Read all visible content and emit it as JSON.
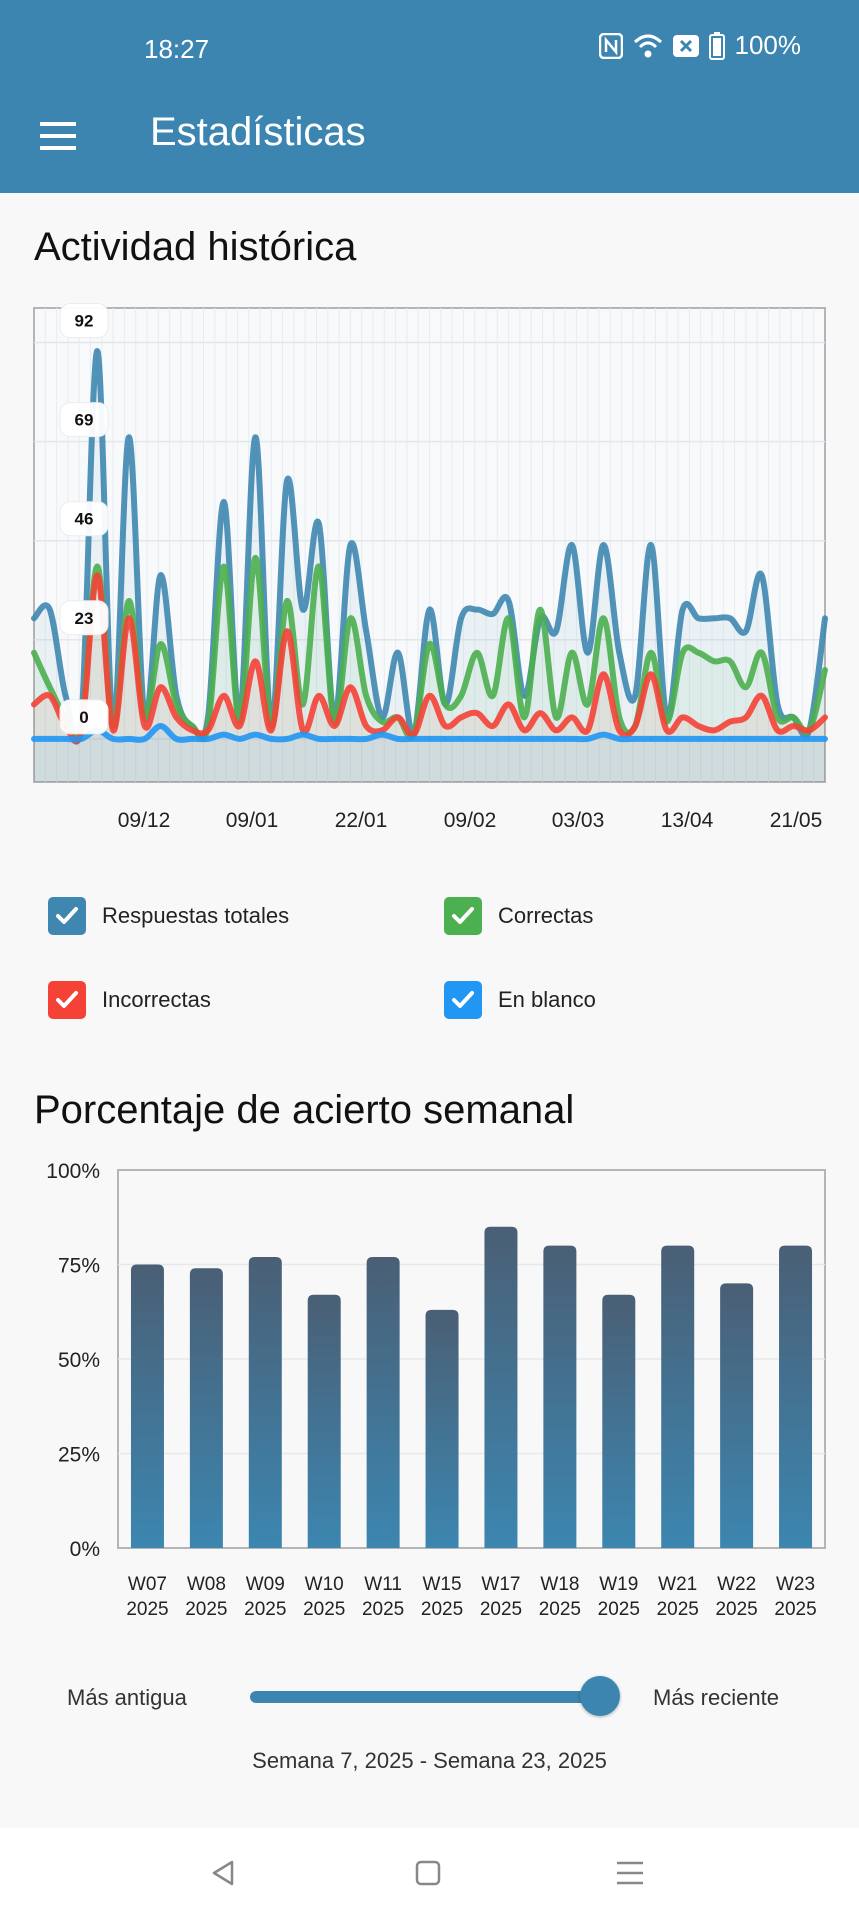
{
  "status": {
    "time": "18:27",
    "battery": "100%"
  },
  "app_bar": {
    "title": "Estadísticas",
    "accent": "#3c85b0"
  },
  "sections": {
    "history_title": "Actividad histórica",
    "weekly_title": "Porcentaje de acierto semanal"
  },
  "legend": [
    {
      "label": "Respuestas totales",
      "color": "#3f87b0",
      "checked": true
    },
    {
      "label": "Correctas",
      "color": "#4caf50",
      "checked": true
    },
    {
      "label": "Incorrectas",
      "color": "#f44336",
      "checked": true
    },
    {
      "label": "En blanco",
      "color": "#2196f3",
      "checked": true
    }
  ],
  "chart_data": [
    {
      "type": "line",
      "x_ticks": [
        "09/12",
        "09/01",
        "22/01",
        "09/02",
        "03/03",
        "13/04",
        "21/05"
      ],
      "y_ticks": [
        0,
        23,
        46,
        69,
        92
      ],
      "ylim": [
        -10,
        100
      ],
      "grid": true,
      "series": [
        {
          "name": "Respuestas totales",
          "color": "#3f87b0",
          "values": [
            28,
            30,
            10,
            5,
            90,
            3,
            70,
            5,
            38,
            10,
            3,
            5,
            55,
            5,
            70,
            3,
            60,
            30,
            50,
            5,
            45,
            25,
            5,
            20,
            1,
            30,
            8,
            28,
            30,
            29,
            32,
            10,
            28,
            25,
            45,
            20,
            45,
            20,
            10,
            45,
            5,
            30,
            28,
            28,
            28,
            25,
            38,
            8,
            5,
            2,
            28
          ]
        },
        {
          "name": "Correctas",
          "color": "#4caf50",
          "values": [
            20,
            12,
            5,
            3,
            40,
            3,
            32,
            5,
            22,
            8,
            3,
            3,
            40,
            4,
            42,
            3,
            32,
            8,
            40,
            4,
            28,
            10,
            4,
            5,
            1,
            22,
            8,
            10,
            20,
            10,
            28,
            5,
            30,
            5,
            20,
            8,
            28,
            5,
            3,
            20,
            4,
            20,
            20,
            18,
            18,
            12,
            20,
            5,
            5,
            2,
            16
          ]
        },
        {
          "name": "Incorrectas",
          "color": "#f44336",
          "values": [
            8,
            10,
            3,
            2,
            38,
            2,
            28,
            3,
            12,
            5,
            2,
            2,
            10,
            3,
            18,
            2,
            25,
            2,
            10,
            3,
            12,
            3,
            2,
            5,
            1,
            10,
            3,
            5,
            6,
            3,
            8,
            2,
            6,
            2,
            5,
            2,
            15,
            2,
            3,
            15,
            2,
            5,
            3,
            2,
            4,
            5,
            10,
            2,
            3,
            2,
            5
          ]
        },
        {
          "name": "En blanco",
          "color": "#2196f3",
          "values": [
            0,
            0,
            0,
            0,
            2,
            0,
            0,
            0,
            3,
            0,
            0,
            0,
            1,
            0,
            1,
            0,
            0,
            1,
            0,
            0,
            0,
            0,
            1,
            0,
            0,
            0,
            0,
            0,
            0,
            0,
            0,
            0,
            0,
            0,
            0,
            0,
            1,
            0,
            0,
            0,
            0,
            0,
            0,
            0,
            0,
            0,
            0,
            0,
            0,
            0,
            0
          ]
        }
      ]
    },
    {
      "type": "bar",
      "categories": [
        "W07",
        "W08",
        "W09",
        "W10",
        "W11",
        "W15",
        "W17",
        "W18",
        "W19",
        "W21",
        "W22",
        "W23"
      ],
      "category_year": "2025",
      "values": [
        75,
        74,
        77,
        67,
        77,
        63,
        85,
        80,
        67,
        80,
        70,
        80
      ],
      "y_ticks": [
        "0%",
        "25%",
        "50%",
        "75%",
        "100%"
      ],
      "ylim": [
        0,
        100
      ],
      "grid": true,
      "colors": {
        "top": "#4a5f75",
        "bottom": "#3c86b0"
      }
    }
  ],
  "slider": {
    "left_label": "Más antigua",
    "right_label": "Más reciente",
    "value": 1.0
  },
  "range_text": "Semana 7, 2025 - Semana 23, 2025"
}
